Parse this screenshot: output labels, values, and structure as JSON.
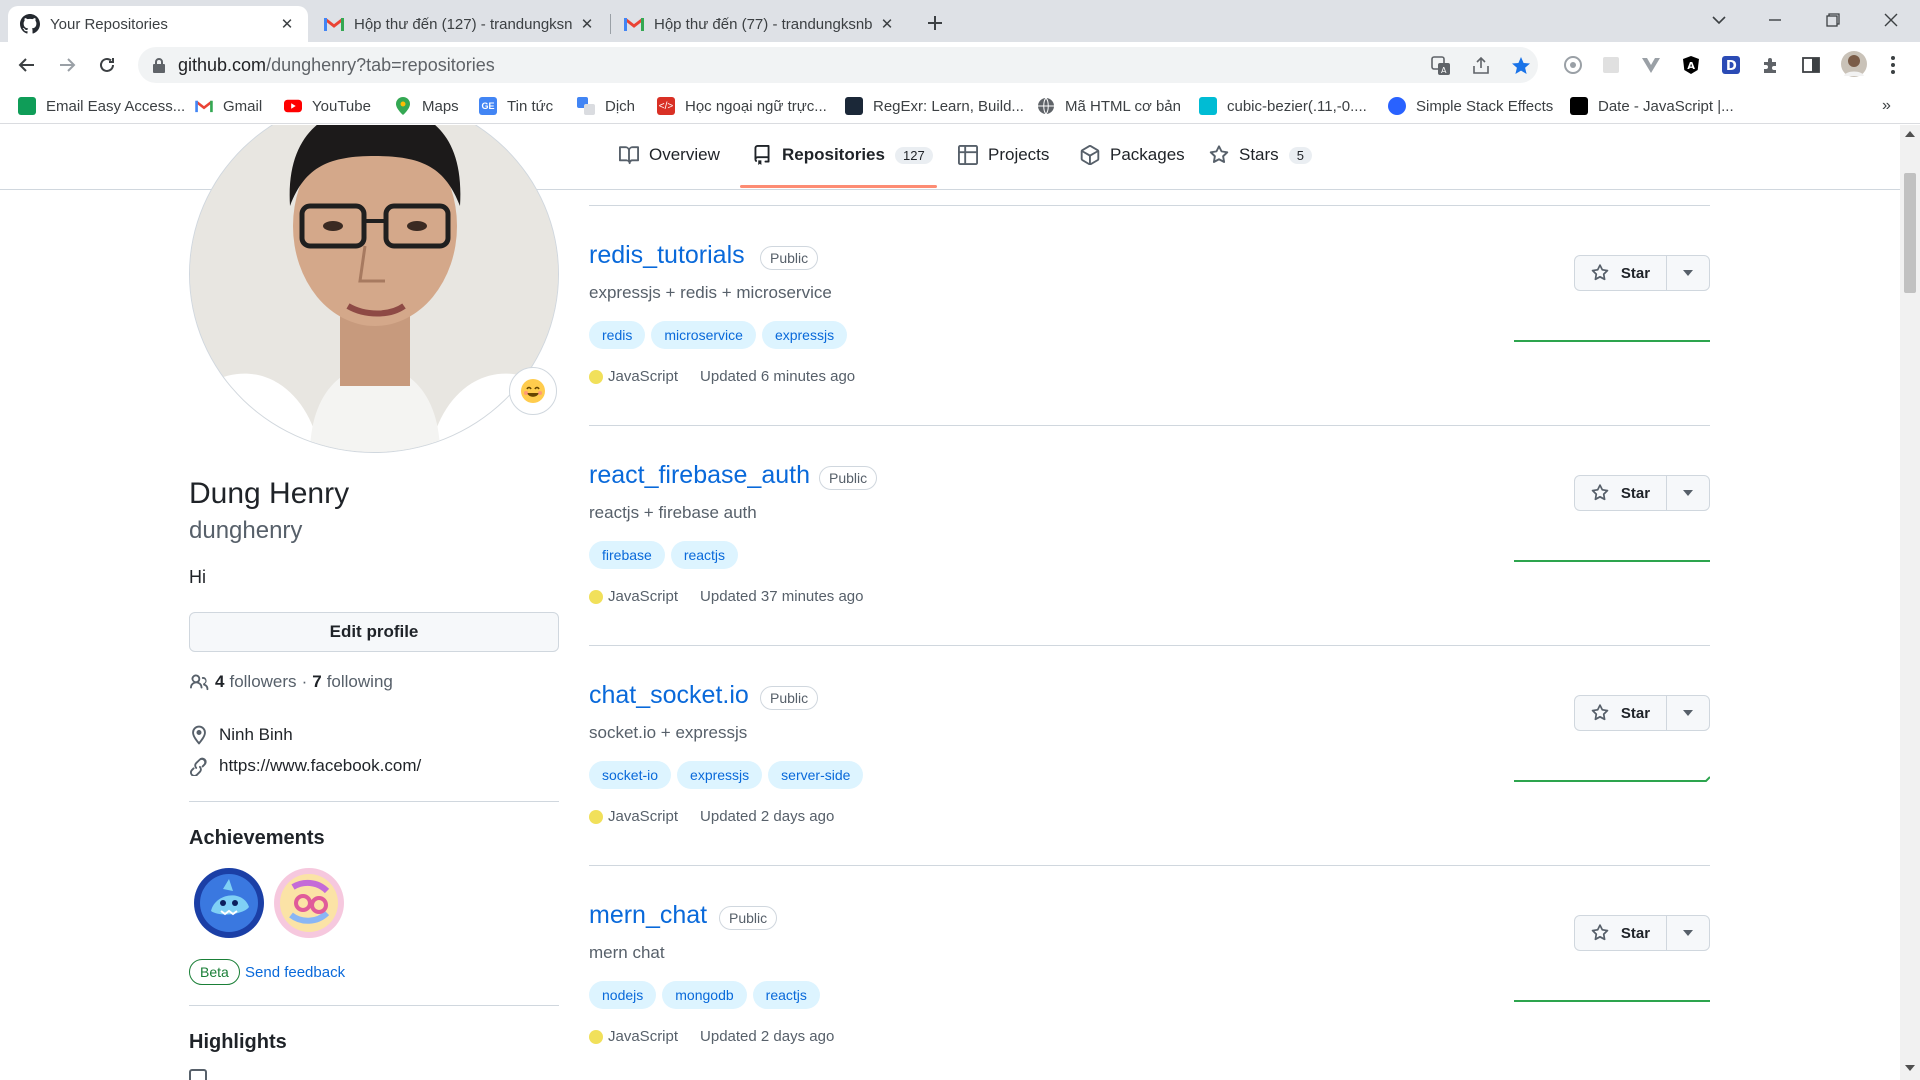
{
  "browser": {
    "tabs": [
      {
        "title": "Your Repositories",
        "icon": "github-icon"
      },
      {
        "title": "Hộp thư đến (127) - trandungksn",
        "icon": "gmail-icon"
      },
      {
        "title": "Hộp thư đến (77) - trandungksnb",
        "icon": "gmail-icon"
      }
    ],
    "url_host": "github.com",
    "url_path": "/dunghenry?tab=repositories",
    "bookmarks": [
      {
        "label": "Email Easy Access...",
        "icon": "email-easy-access-icon"
      },
      {
        "label": "Gmail",
        "icon": "gmail-icon"
      },
      {
        "label": "YouTube",
        "icon": "youtube-icon"
      },
      {
        "label": "Maps",
        "icon": "maps-icon"
      },
      {
        "label": "Tin tức",
        "icon": "news-icon"
      },
      {
        "label": "Dịch",
        "icon": "translate-icon"
      },
      {
        "label": "Học ngoại ngữ trực...",
        "icon": "language-learning-icon"
      },
      {
        "label": "RegExr: Learn, Build...",
        "icon": "regexr-icon"
      },
      {
        "label": "Mã HTML cơ bản",
        "icon": "globe-icon"
      },
      {
        "label": "cubic-bezier(.11,-0....",
        "icon": "cubic-bezier-icon"
      },
      {
        "label": "Simple Stack Effects",
        "icon": "drop-icon"
      },
      {
        "label": "Date - JavaScript |...",
        "icon": "mdn-icon"
      }
    ]
  },
  "profile_nav": [
    {
      "label": "Overview",
      "icon": "book-icon"
    },
    {
      "label": "Repositories",
      "icon": "repo-icon",
      "count": "127"
    },
    {
      "label": "Projects",
      "icon": "table-icon"
    },
    {
      "label": "Packages",
      "icon": "package-icon"
    },
    {
      "label": "Stars",
      "icon": "star-icon",
      "count": "5"
    }
  ],
  "profile": {
    "name": "Dung Henry",
    "login": "dunghenry",
    "bio": "Hi",
    "edit_label": "Edit profile",
    "followers_count": "4",
    "followers_label": "followers",
    "following_count": "7",
    "following_label": "following",
    "location": "Ninh Binh",
    "website": "https://www.facebook.com/",
    "achievements_title": "Achievements",
    "beta_label": "Beta",
    "feedback_label": "Send feedback",
    "highlights_title": "Highlights"
  },
  "repos": [
    {
      "name": "redis_tutorials",
      "visibility": "Public",
      "description": "expressjs + redis + microservice",
      "topics": [
        "redis",
        "microservice",
        "expressjs"
      ],
      "language": "JavaScript",
      "updated": "Updated 6 minutes ago",
      "star_label": "Star"
    },
    {
      "name": "react_firebase_auth",
      "visibility": "Public",
      "description": "reactjs + firebase auth",
      "topics": [
        "firebase",
        "reactjs"
      ],
      "language": "JavaScript",
      "updated": "Updated 37 minutes ago",
      "star_label": "Star"
    },
    {
      "name": "chat_socket.io",
      "visibility": "Public",
      "description": "socket.io + expressjs",
      "topics": [
        "socket-io",
        "expressjs",
        "server-side"
      ],
      "language": "JavaScript",
      "updated": "Updated 2 days ago",
      "star_label": "Star"
    },
    {
      "name": "mern_chat",
      "visibility": "Public",
      "description": "mern chat",
      "topics": [
        "nodejs",
        "mongodb",
        "reactjs"
      ],
      "language": "JavaScript",
      "updated": "Updated 2 days ago",
      "star_label": "Star"
    }
  ],
  "colors": {
    "link": "#0969da",
    "javascript": "#f1e05a",
    "topic_bg": "#ddf4ff",
    "underline": "#fd8c73",
    "sparkline": "#2da44e"
  }
}
